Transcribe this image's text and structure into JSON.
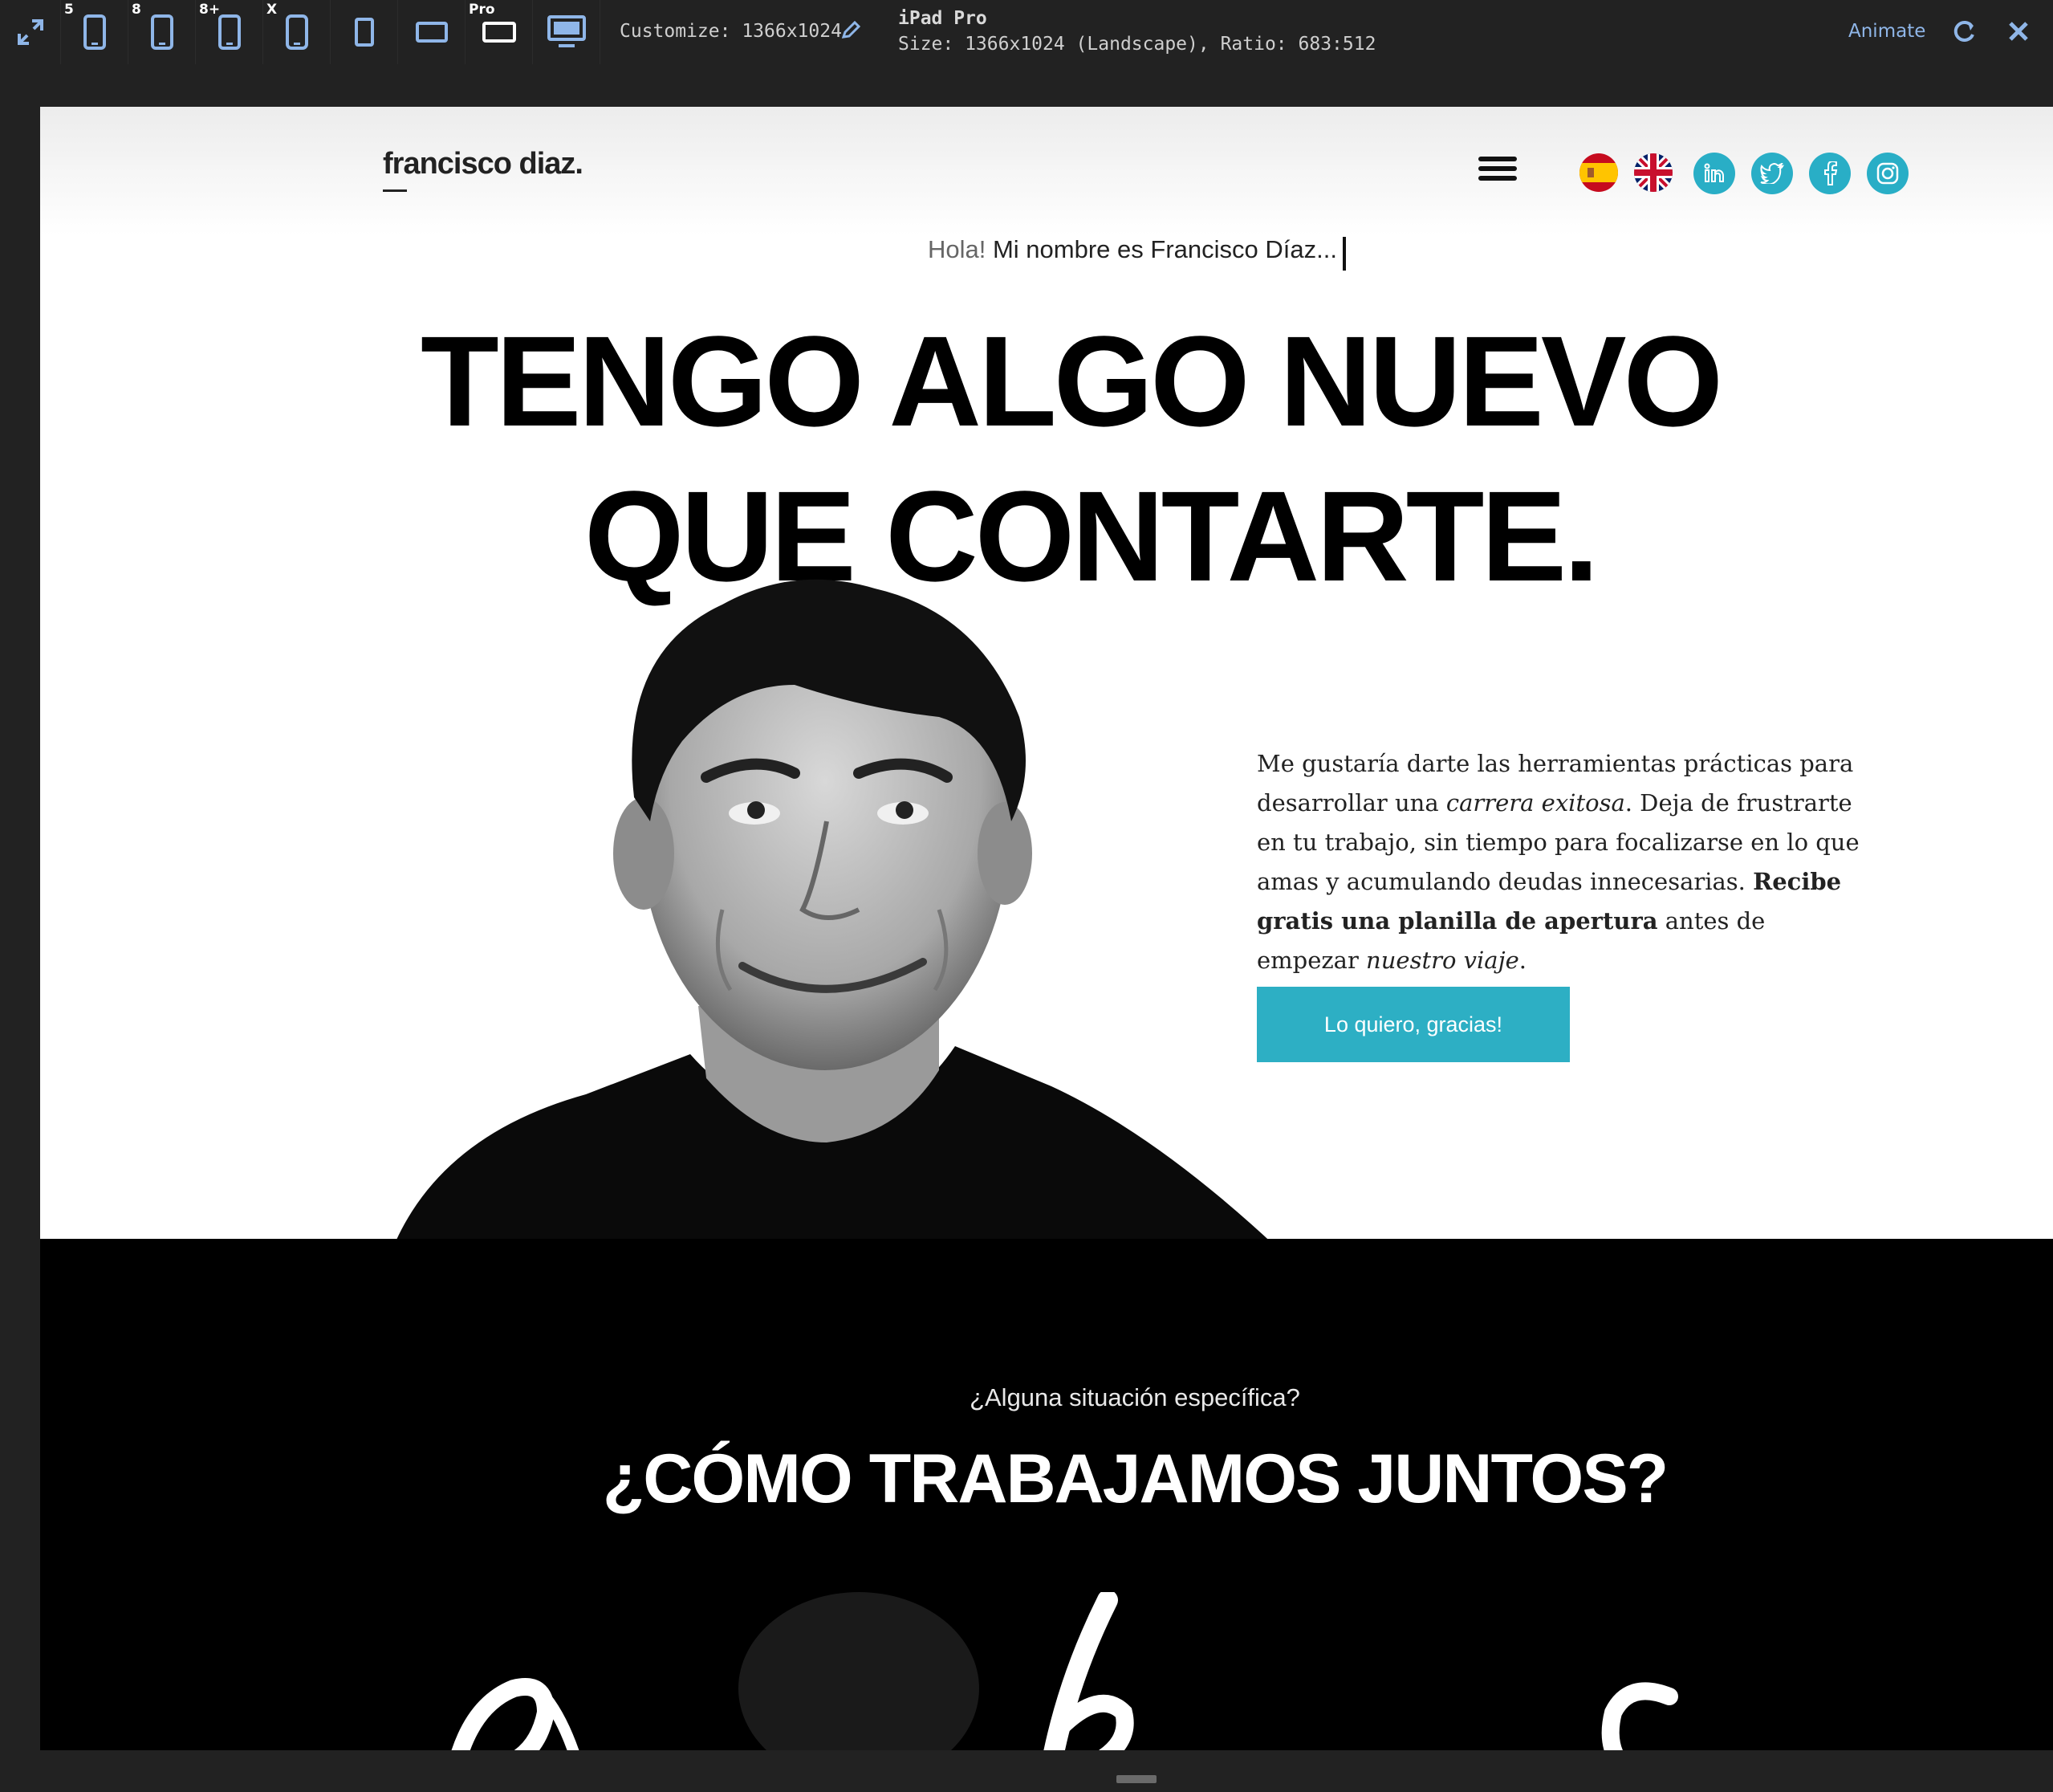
{
  "toolbar": {
    "devices": [
      {
        "name": "fullscreen",
        "badge": ""
      },
      {
        "name": "iphone-5",
        "badge": "5"
      },
      {
        "name": "iphone-8",
        "badge": "8"
      },
      {
        "name": "iphone-8-plus",
        "badge": "8+"
      },
      {
        "name": "iphone-x",
        "badge": "X"
      },
      {
        "name": "ipad",
        "badge": ""
      },
      {
        "name": "ipad-landscape",
        "badge": ""
      },
      {
        "name": "ipad-pro",
        "badge": "Pro"
      },
      {
        "name": "desktop",
        "badge": ""
      }
    ],
    "customize_label": "Customize: 1366x1024",
    "device_name": "iPad Pro",
    "device_size": "Size: 1366x1024 (Landscape), Ratio: 683:512",
    "animate_label": "Animate"
  },
  "site": {
    "logo": "francisco diaz.",
    "flags": [
      "es",
      "gb"
    ],
    "socials": [
      "linkedin",
      "twitter",
      "facebook",
      "instagram"
    ]
  },
  "hero": {
    "greeting_hola": "Hola!",
    "greeting_rest": " Mi nombre es Francisco Díaz...",
    "headline_line1": "TENGO ALGO NUEVO",
    "headline_line2": "QUE CONTARTE.",
    "body_1": "Me gustaría darte las herramientas prácticas para desarrollar una ",
    "body_em1": "carrera exitosa",
    "body_2": ". Deja de frustrarte en tu trabajo, sin tiempo para focalizarse en lo que amas y acumulando deudas innecesarias. ",
    "body_strong": "Recibe gratis una planilla de apertura",
    "body_3": " antes de empezar ",
    "body_em2": "nuestro viaje",
    "body_4": ".",
    "cta_label": "Lo quiero, gracias!"
  },
  "section": {
    "subtitle": "¿Alguna situación específica?",
    "title": "¿CÓMO TRABAJAMOS JUNTOS?"
  },
  "colors": {
    "accent": "#2dafc4",
    "toolbar_bg": "#222222",
    "icon_blue": "#8fb6e8"
  }
}
